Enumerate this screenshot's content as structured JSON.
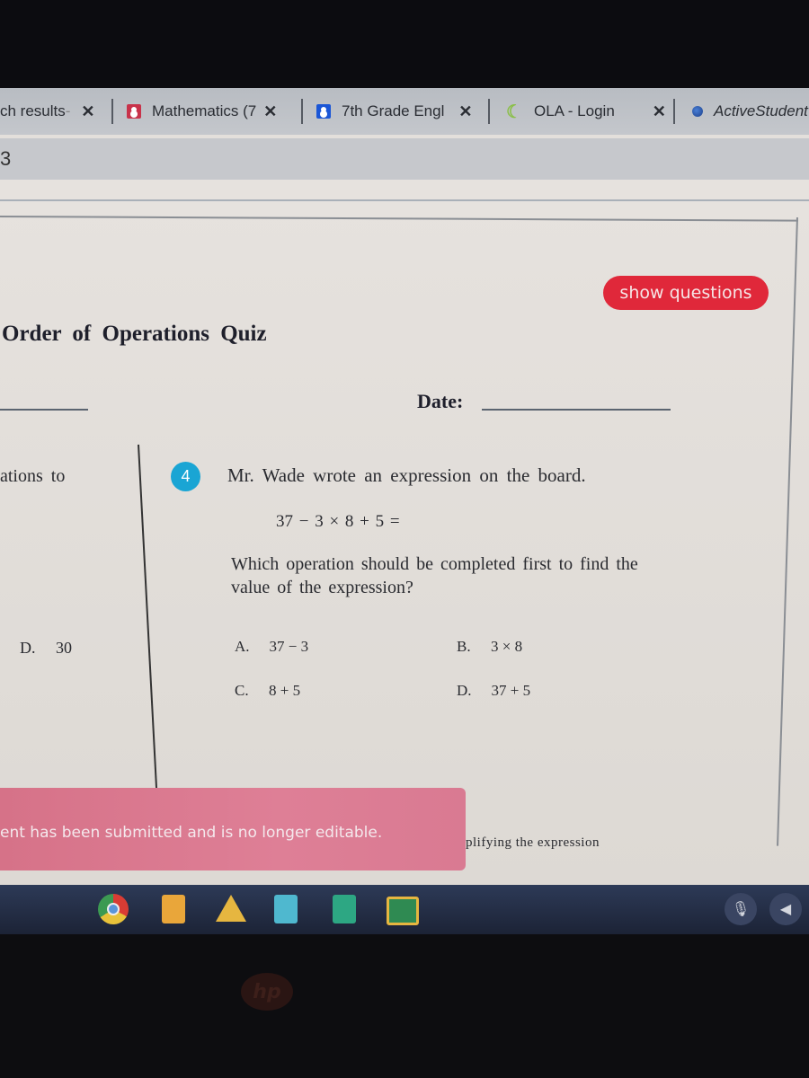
{
  "browser": {
    "tabs": [
      {
        "label": "ch results",
        "favicon": "partial",
        "suffix": " -"
      },
      {
        "label": "Mathematics (7",
        "favicon": "classroom-red-person-icon"
      },
      {
        "label": "7th Grade Engl",
        "favicon": "classroom-blue-person-icon"
      },
      {
        "label": "OLA - Login",
        "favicon": "ola-icon"
      },
      {
        "label": "ActiveStudent",
        "favicon": "globe-icon"
      }
    ],
    "close_glyph": "✕",
    "toolbar_fragment": "3"
  },
  "page": {
    "show_questions_label": "show questions",
    "quiz_title": "Order of Operations Quiz",
    "date_label": "Date:",
    "left_column": {
      "prompt_fragment": "ations to",
      "answer_fragment": {
        "letter": "D.",
        "value": "30"
      }
    },
    "question": {
      "number": "4",
      "text": "Mr. Wade wrote an expression on the board.",
      "expression": "37 − 3 × 8 + 5 =",
      "prompt": "Which operation should be completed first to find the value of the expression?",
      "choices": [
        {
          "letter": "A.",
          "value": "37 − 3"
        },
        {
          "letter": "B.",
          "value": "3 × 8"
        },
        {
          "letter": "C.",
          "value": "8 + 5"
        },
        {
          "letter": "D.",
          "value": "37 + 5"
        }
      ]
    },
    "submitted_banner": "ent has been submitted and is no longer editable.",
    "hint_fragment": "plifying the expression",
    "accent_colors": {
      "show_button": "#e0283a",
      "question_badge": "#1aa5d4",
      "banner": "#d67288"
    }
  },
  "shelf": {
    "apps": [
      "chrome-icon",
      "slides-icon",
      "drive-icon",
      "docs-icon",
      "sheets-icon",
      "classroom-icon"
    ],
    "tray": [
      "microphone-icon",
      "volume-icon"
    ]
  },
  "device": {
    "logo": "hp"
  }
}
